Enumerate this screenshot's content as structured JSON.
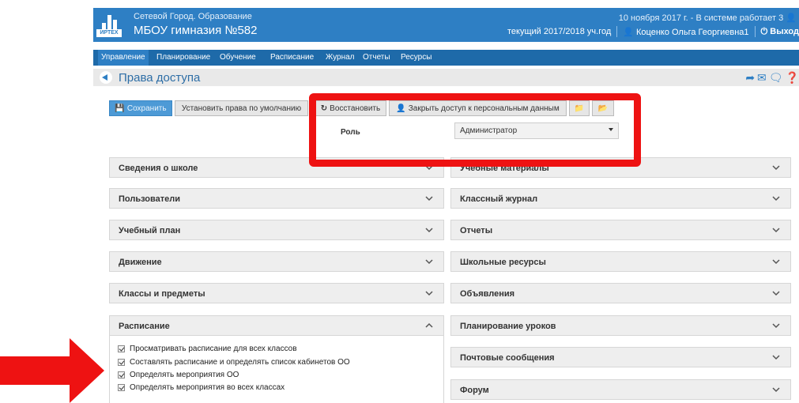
{
  "header": {
    "app_name": "Сетевой Город. Образование",
    "school_name": "МБОУ гимназия №582",
    "logo_brand": "ИРТЕХ",
    "date_status": "10 ноября 2017 г. - В системе работает 3",
    "year": "текущий 2017/2018 уч.год",
    "user": "Коценко Ольга Георгиевна1",
    "logout": "Выход"
  },
  "menu": [
    {
      "label": "Управление",
      "active": true
    },
    {
      "label": "Планирование"
    },
    {
      "label": "Обучение"
    },
    {
      "label": "Расписание"
    },
    {
      "label": "Журнал"
    },
    {
      "label": "Отчеты"
    },
    {
      "label": "Ресурсы"
    }
  ],
  "page": {
    "title": "Права доступа"
  },
  "toolbar": {
    "save": "Сохранить",
    "defaults": "Установить права по умолчанию",
    "restore": "Восстановить",
    "close_personal": "Закрыть доступ к персональным данным"
  },
  "role": {
    "label": "Роль",
    "value": "Администратор"
  },
  "panels_left": [
    {
      "title": "Сведения о школе",
      "expanded": false
    },
    {
      "title": "Пользователи",
      "expanded": false
    },
    {
      "title": "Учебный план",
      "expanded": false
    },
    {
      "title": "Движение",
      "expanded": false
    },
    {
      "title": "Классы и предметы",
      "expanded": false
    },
    {
      "title": "Расписание",
      "expanded": true
    }
  ],
  "panels_right": [
    {
      "title": "Учебные материалы"
    },
    {
      "title": "Классный журнал"
    },
    {
      "title": "Отчеты"
    },
    {
      "title": "Школьные ресурсы"
    },
    {
      "title": "Объявления"
    },
    {
      "title": "Планирование уроков"
    },
    {
      "title": "Почтовые сообщения"
    },
    {
      "title": "Форум"
    }
  ],
  "schedule_permissions": [
    {
      "label": "Просматривать расписание для всех классов",
      "checked": true
    },
    {
      "label": "Составлять расписание и определять список кабинетов ОО",
      "checked": true
    },
    {
      "label": "Определять мероприятия ОО",
      "checked": true
    },
    {
      "label": "Определять мероприятия во всех классах",
      "checked": true
    }
  ],
  "colors": {
    "brand_blue": "#2e7fc4",
    "menu_blue": "#1e6aa9",
    "highlight_red": "#ee1212"
  },
  "icons": {
    "logo": "bar-chart-icon",
    "user": "user-icon",
    "power": "power-icon",
    "back": "arrow-left-circle-icon",
    "save": "floppy-icon",
    "restore": "refresh-icon",
    "lock_user": "user-icon",
    "folder": "folder-icon",
    "folder_open": "folder-open-icon",
    "chevron": "chevron-down-icon",
    "chevron_up": "chevron-up-icon"
  }
}
